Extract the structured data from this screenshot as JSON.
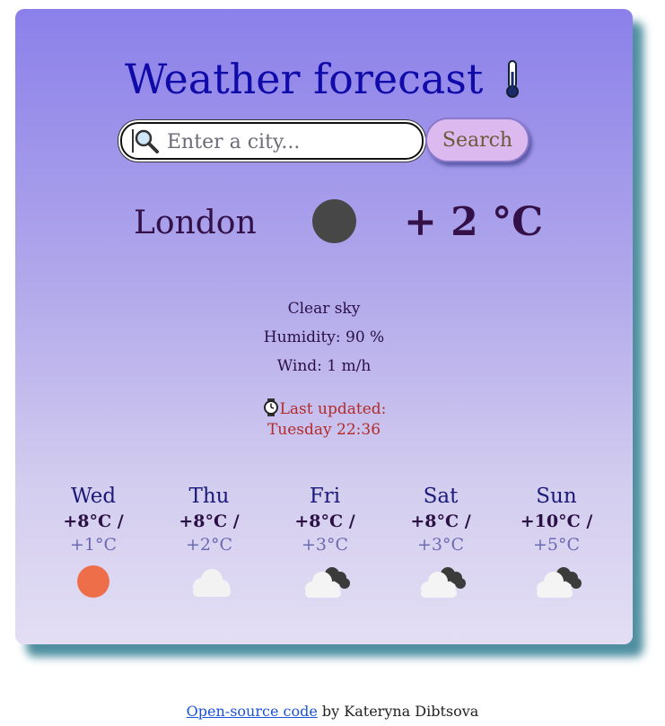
{
  "header": {
    "title": "Weather forecast",
    "title_icon": "thermometer-icon"
  },
  "search": {
    "placeholder": "Enter a city...",
    "button_label": "Search",
    "icon": "magnifier-icon"
  },
  "current": {
    "city": "London",
    "temperature": "+ 2 °C",
    "icon": "moon-dark-circle-icon",
    "description": "Clear sky",
    "humidity": "Humidity: 90 %",
    "wind": "Wind: 1 m/h",
    "updated_label": "Last updated:",
    "updated_time": "Tuesday 22:36"
  },
  "forecast": [
    {
      "day": "Wed",
      "max": "+8°C /",
      "min": "+1°C",
      "icon": "sun-icon"
    },
    {
      "day": "Thu",
      "max": "+8°C /",
      "min": "+2°C",
      "icon": "cloud-icon"
    },
    {
      "day": "Fri",
      "max": "+8°C /",
      "min": "+3°C",
      "icon": "broken-clouds-icon"
    },
    {
      "day": "Sat",
      "max": "+8°C /",
      "min": "+3°C",
      "icon": "broken-clouds-icon"
    },
    {
      "day": "Sun",
      "max": "+10°C /",
      "min": "+5°C",
      "icon": "broken-clouds-icon"
    }
  ],
  "footer": {
    "link_text": "Open-source code",
    "suffix": "by Kateryna Dibtsova"
  },
  "colors": {
    "title": "#0f0aa8",
    "updated": "#b22a2a",
    "button_bg": "#dcb9ee",
    "sun": "#ef6e4a"
  }
}
